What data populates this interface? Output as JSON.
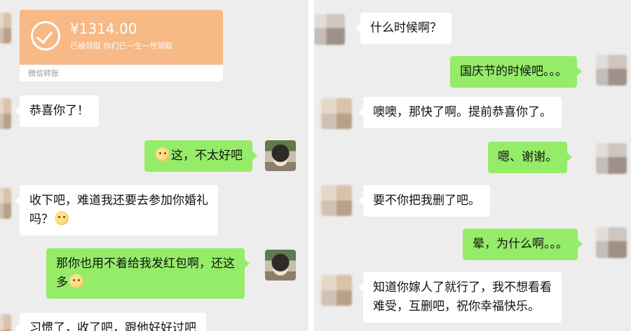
{
  "left": {
    "transfer": {
      "amount": "¥1314.00",
      "status": "已被领取  你们已一生一世领取",
      "footer": "微信转账"
    },
    "messages": {
      "congrats": "恭喜你了！",
      "not_good": "这，不太好吧",
      "take_it_1": "收下吧，难道我还要去参加你婚礼",
      "take_it_2": "吗？",
      "no_need_1": "那你也用不着给我发红包啊，还这",
      "no_need_2": "多",
      "habit": "习惯了，收了吧，跟他好好过吧"
    }
  },
  "right": {
    "messages": {
      "when": "什么时候啊？",
      "national_day": "国庆节的时候吧。。。",
      "soon": "噢噢，那快了啊。提前恭喜你了。",
      "thanks": "嗯、谢谢。",
      "delete": "要不你把我删了吧。",
      "why": "晕，为什么啊。。。",
      "final_1": "知道你嫁人了就行了，我不想看看",
      "final_2": "难受，互删吧，祝你幸福快乐。"
    }
  },
  "colors": {
    "background": "#ededed",
    "bubble_in": "#ffffff",
    "bubble_out": "#95ec69",
    "transfer": "#f7b985"
  },
  "icons": [
    "check-circle-icon",
    "emoji-icon"
  ]
}
